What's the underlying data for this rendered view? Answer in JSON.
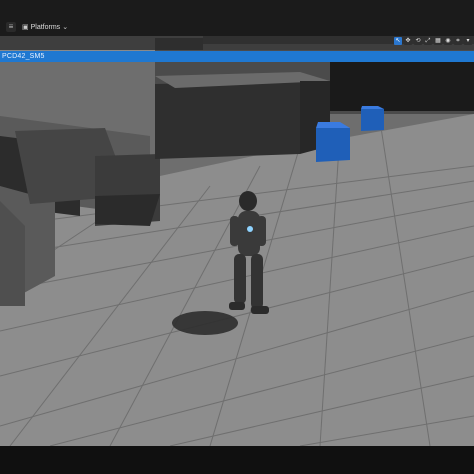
{
  "toolbar": {
    "menu_icon": "menu-icon",
    "platform_label": "Platforms",
    "platform_icon": "chevron-down-icon"
  },
  "viewport": {
    "selection_label": "PCD42_SM5",
    "toolbar_icons": [
      "select-icon",
      "move-icon",
      "rotate-icon",
      "scale-icon",
      "snap-icon",
      "camera-icon",
      "grid-icon",
      "more-icon"
    ]
  }
}
